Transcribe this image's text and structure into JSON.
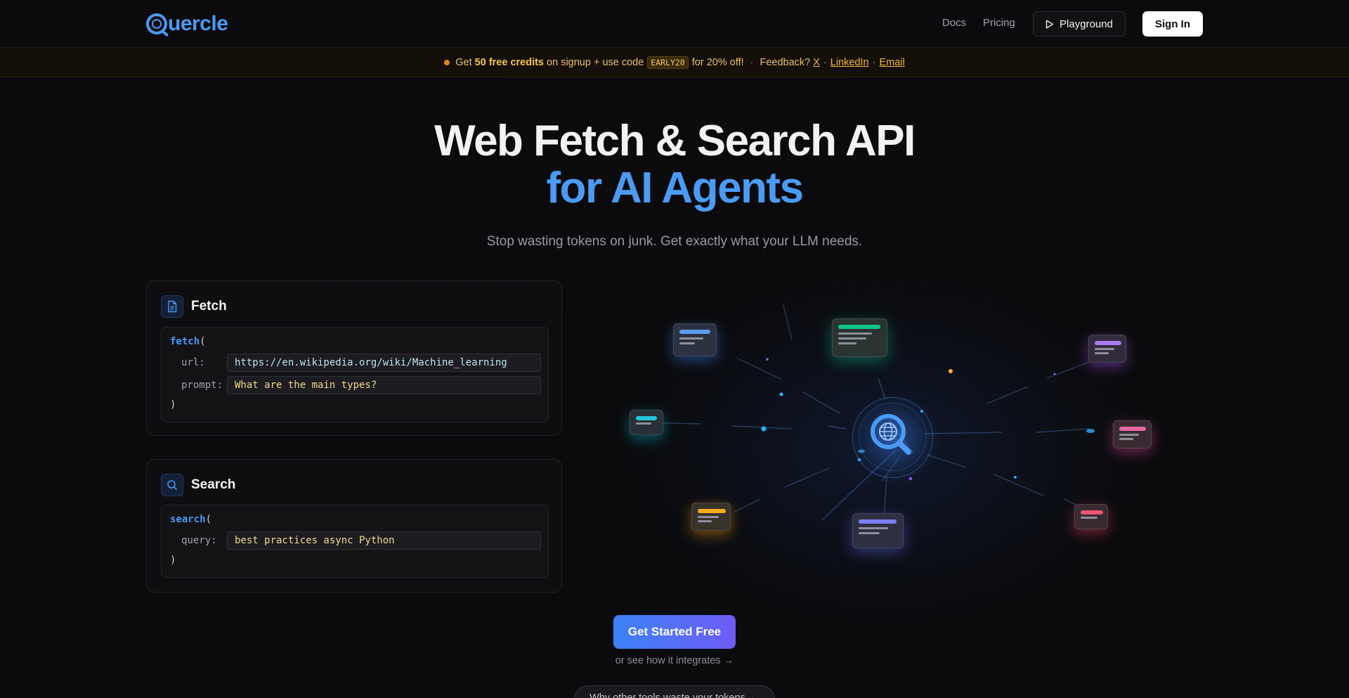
{
  "header": {
    "logo_text": "uercle",
    "logo_letter": "Q",
    "nav": {
      "docs": "Docs",
      "pricing": "Pricing"
    },
    "playground_label": "Playground",
    "signin_label": "Sign In"
  },
  "banner": {
    "text_get": "Get",
    "bold_credits": "50 free credits",
    "text_signup": "on signup + use code",
    "code": "EARLY20",
    "text_off": "for 20% off!",
    "separator": "·",
    "feedback": "Feedback?",
    "links": {
      "x": "X",
      "linkedin": "LinkedIn",
      "email": "Email"
    },
    "link_sep": "·"
  },
  "hero": {
    "title_line1": "Web Fetch & Search API",
    "title_line2": "for AI Agents",
    "subtitle": "Stop wasting tokens on junk. Get exactly what your LLM needs."
  },
  "fetch_card": {
    "title": "Fetch",
    "fn_name": "fetch",
    "open_paren": "(",
    "close_paren": ")",
    "url_label": "url:",
    "url_value": "https://en.wikipedia.org/wiki/Machine_learning",
    "prompt_label": "prompt:",
    "prompt_value": "What are the main types?"
  },
  "search_card": {
    "title": "Search",
    "fn_name": "search",
    "open_paren": "(",
    "close_paren": ")",
    "query_label": "query:",
    "query_value": "best practices async Python"
  },
  "cta": {
    "primary_label": "Get Started Free",
    "secondary_link": "or see how it integrates →",
    "why_pill": "Why other tools waste your tokens"
  },
  "colors": {
    "accent": "#4b9bf5",
    "banner_text": "#e8c070",
    "cta_gradient_start": "#3b82f6",
    "cta_gradient_end": "#6f5cf6"
  },
  "icons": {
    "playground": "play-icon",
    "fetch": "document-icon",
    "search": "search-icon",
    "hub": "globe-search-icon",
    "why_pill": "chevron-down-icon"
  }
}
